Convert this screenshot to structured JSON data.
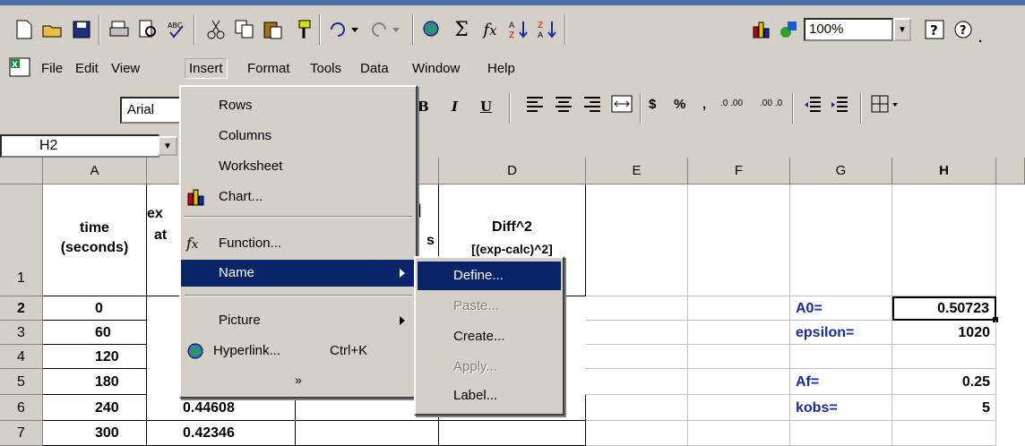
{
  "menu": {
    "items": [
      {
        "label": "File",
        "key": "F"
      },
      {
        "label": "Edit",
        "key": "E"
      },
      {
        "label": "View",
        "key": "V"
      },
      {
        "label": "Insert",
        "key": "I"
      },
      {
        "label": "Format",
        "key": "o"
      },
      {
        "label": "Tools",
        "key": "T"
      },
      {
        "label": "Data",
        "key": "D"
      },
      {
        "label": "Window",
        "key": "W"
      },
      {
        "label": "Help",
        "key": "H"
      }
    ]
  },
  "toolbar": {
    "zoom": "100%",
    "font_name": "Arial",
    "icons": [
      "new-icon",
      "open-icon",
      "save-icon",
      "print-icon",
      "print-preview-icon",
      "spelling-icon",
      "cut-icon",
      "copy-icon",
      "paste-icon",
      "format-painter-icon",
      "undo-icon",
      "redo-icon",
      "hyperlink-icon",
      "autosum-icon",
      "function-icon",
      "sort-asc-icon",
      "sort-desc-icon",
      "chart-wizard-icon",
      "drawing-icon"
    ],
    "format_buttons": [
      "B",
      "I",
      "U"
    ]
  },
  "namebox": {
    "value": "H2"
  },
  "insert_menu": {
    "items": [
      "Rows",
      "Columns",
      "Worksheet",
      "Chart...",
      "Function...",
      "Name",
      "Picture",
      "Hyperlink..."
    ],
    "hyperlink_shortcut": "Ctrl+K",
    "more": "»"
  },
  "name_submenu": {
    "items": [
      "Define...",
      "Paste...",
      "Create...",
      "Apply...",
      "Label..."
    ]
  },
  "grid": {
    "columns": [
      "A",
      "B",
      "C",
      "D",
      "E",
      "F",
      "G",
      "H"
    ],
    "rows": [
      "1",
      "2",
      "3",
      "4",
      "5",
      "6",
      "7"
    ],
    "headers": {
      "a1_line1": "time",
      "a1_line2": "(seconds)",
      "b1_frag1": "ex",
      "b1_frag2": "at",
      "c1_frag1": "|",
      "c1_frag2": "s",
      "d1_line1": "Diff^2",
      "d1_line2": "[(exp-calc)^2]"
    },
    "time_values": [
      "0",
      "60",
      "120",
      "180",
      "240",
      "300"
    ],
    "b_values": [
      "0.44608",
      "0.42346"
    ],
    "params": [
      {
        "label": "A0=",
        "value": "0.50723"
      },
      {
        "label": "epsilon=",
        "value": "1020"
      },
      {
        "label": "Af=",
        "value": "0.25"
      },
      {
        "label": "kobs=",
        "value": "5"
      }
    ]
  }
}
